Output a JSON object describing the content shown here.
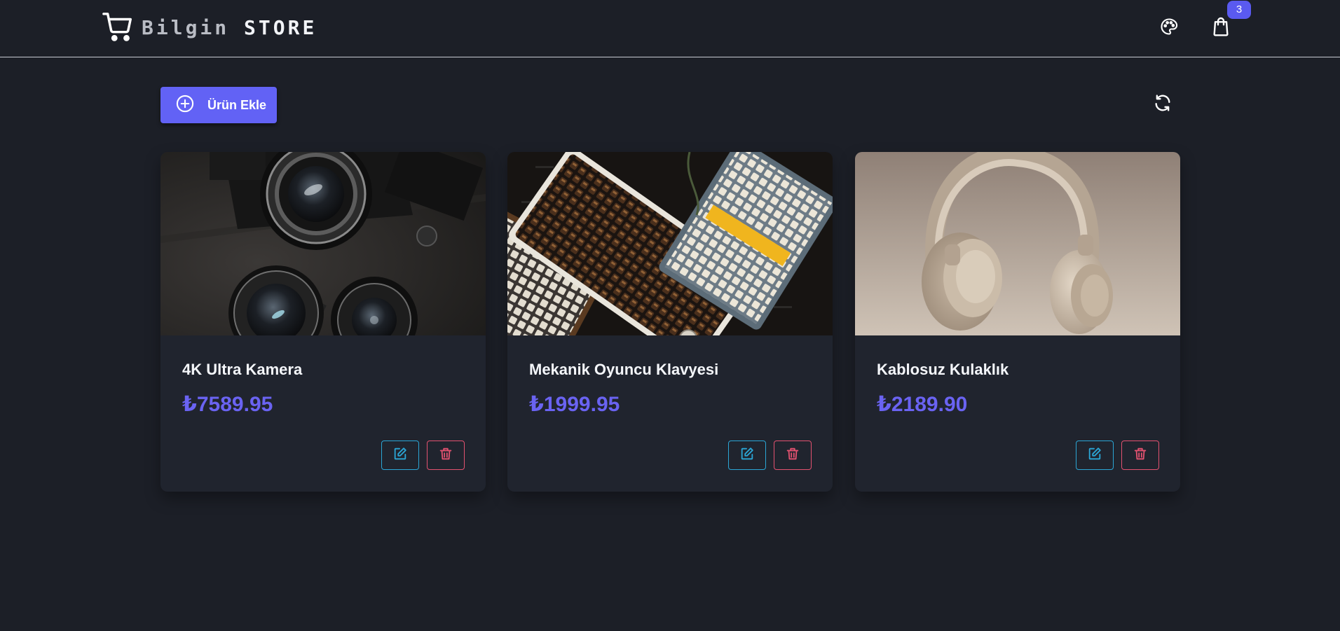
{
  "header": {
    "brand_word1": "Bilgin",
    "brand_word2": "STORE",
    "cart_count": "3",
    "icons": {
      "brand": "shopping-cart-icon",
      "theme": "palette-icon",
      "cart": "shopping-bag-icon"
    }
  },
  "toolbar": {
    "add_label": "Ürün Ekle",
    "icons": {
      "add": "plus-circle-icon",
      "refresh": "refresh-icon"
    }
  },
  "products": [
    {
      "title": "4K Ultra Kamera",
      "price": "₺7589.95",
      "image": "camera-lenses-photo"
    },
    {
      "title": "Mekanik Oyuncu Klavyesi",
      "price": "₺1999.95",
      "image": "mechanical-keyboards-photo"
    },
    {
      "title": "Kablosuz Kulaklık",
      "price": "₺2189.90",
      "image": "wireless-headphones-photo"
    }
  ],
  "colors": {
    "background": "#1c1f27",
    "card": "#20242e",
    "accent": "#6262f5",
    "price": "#6a63f2",
    "edit": "#2ba6d6",
    "delete": "#e35270"
  }
}
